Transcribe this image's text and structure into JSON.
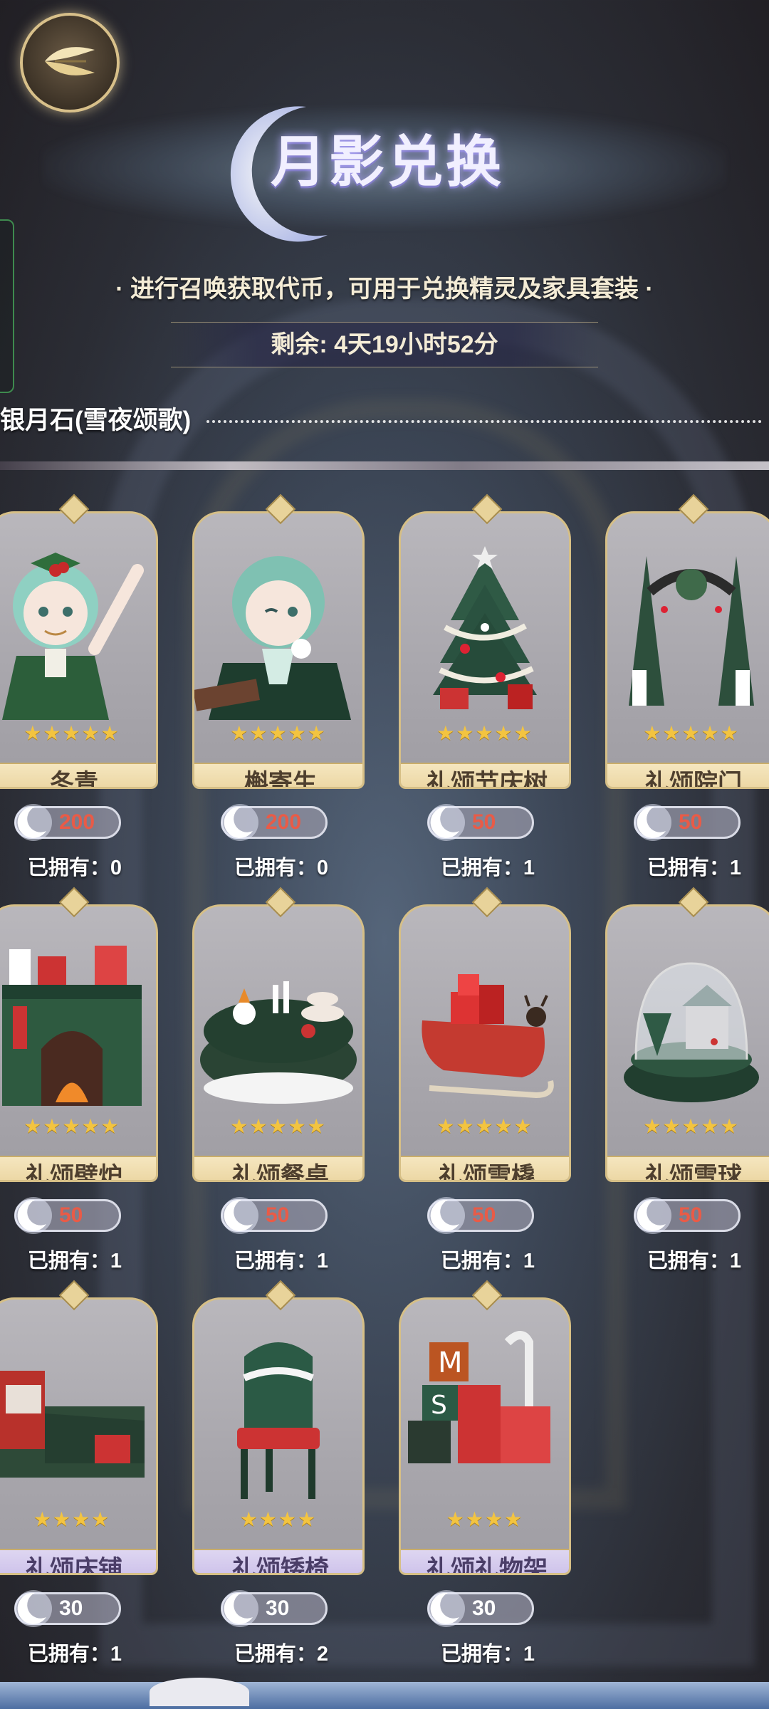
{
  "header": {
    "back_icon": "leaf-wing-back-icon",
    "title": "月影兑换",
    "subtitle": "· 进行召唤获取代币，可用于兑换精灵及家具套装 ·",
    "timer": "剩余: 4天19小时52分"
  },
  "currency": {
    "label": "银月石(雪夜颂歌)",
    "icon": "crescent-moon-icon"
  },
  "colors": {
    "price_red": "#e95b47",
    "star_gold": "#f3c440",
    "gold_plate": "#e7cf95",
    "purple_plate": "#c6b9e8"
  },
  "items": [
    {
      "name": "冬青",
      "stars": "★★★★★",
      "price": "200",
      "owned": "已拥有：0",
      "art": "holly-girl"
    },
    {
      "name": "槲寄生",
      "stars": "★★★★★",
      "price": "200",
      "owned": "已拥有：0",
      "art": "mistletoe-boy"
    },
    {
      "name": "礼颂节庆树",
      "stars": "★★★★★",
      "price": "50",
      "owned": "已拥有：1",
      "art": "christmas-tree"
    },
    {
      "name": "礼颂院门",
      "stars": "★★★★★",
      "price": "50",
      "owned": "已拥有：1",
      "art": "garden-gate"
    },
    {
      "name": "礼颂壁炉",
      "stars": "★★★★★",
      "price": "50",
      "owned": "已拥有：1",
      "art": "fireplace"
    },
    {
      "name": "礼颂餐桌",
      "stars": "★★★★★",
      "price": "50",
      "owned": "已拥有：1",
      "art": "dining-table"
    },
    {
      "name": "礼颂雪橇",
      "stars": "★★★★★",
      "price": "50",
      "owned": "已拥有：1",
      "art": "sleigh"
    },
    {
      "name": "礼颂雪球",
      "stars": "★★★★★",
      "price": "50",
      "owned": "已拥有：1",
      "art": "snow-globe"
    },
    {
      "name": "礼颂床铺",
      "stars": "★★★★",
      "price": "30",
      "owned": "已拥有：1",
      "art": "bed"
    },
    {
      "name": "礼颂矮椅",
      "stars": "★★★★",
      "price": "30",
      "owned": "已拥有：2",
      "art": "chair"
    },
    {
      "name": "礼颂礼物架",
      "stars": "★★★★",
      "price": "30",
      "owned": "已拥有：1",
      "art": "gift-shelf"
    }
  ]
}
